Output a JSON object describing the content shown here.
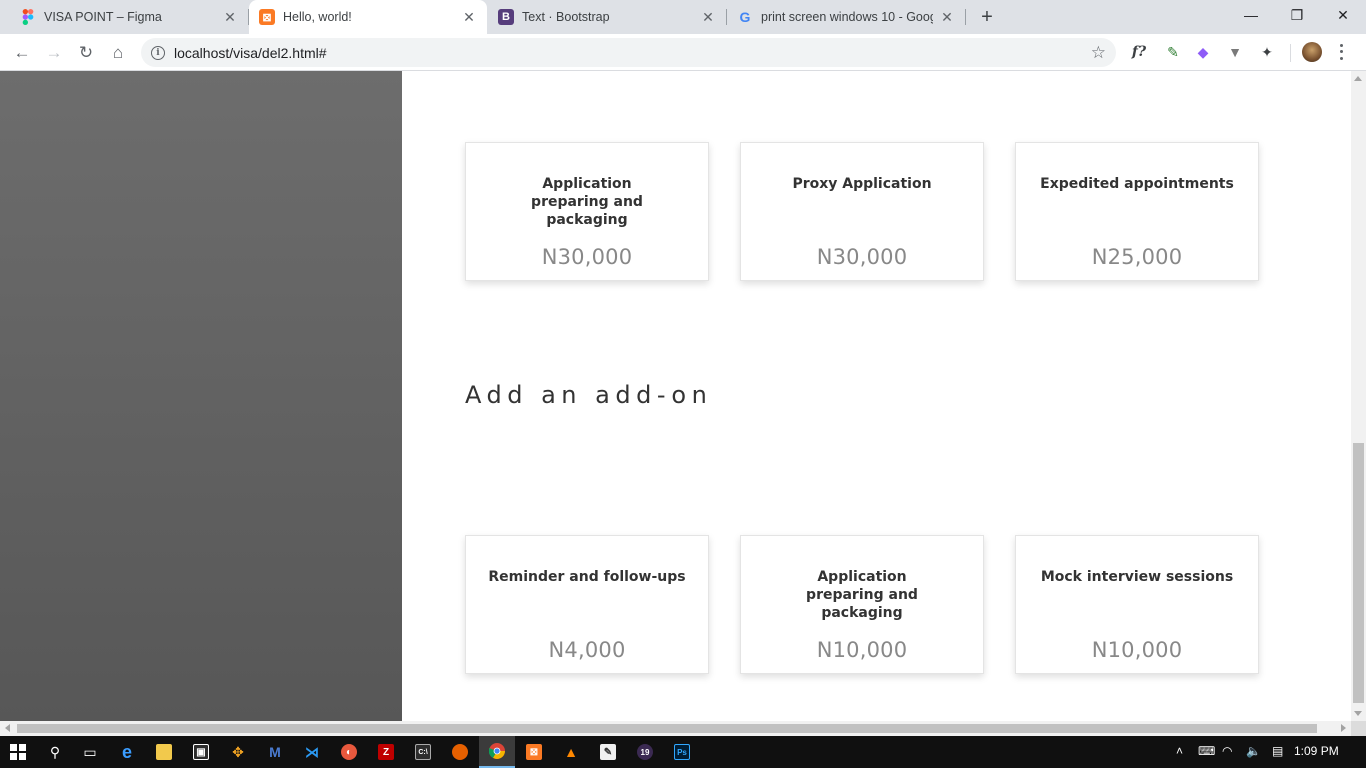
{
  "browser": {
    "tabs": [
      {
        "title": "VISA POINT – Figma",
        "icon": "figma-icon",
        "color": "#f24e1e"
      },
      {
        "title": "Hello, world!",
        "icon": "xampp-icon",
        "color": "#fb7a24"
      },
      {
        "title": "Text · Bootstrap",
        "icon": "bootstrap-icon",
        "color": "#563d7c"
      },
      {
        "title": "print screen windows 10 - Googl",
        "icon": "google-icon",
        "color": "#4285f4"
      }
    ],
    "url": "localhost/visa/del2.html#"
  },
  "page": {
    "services": [
      {
        "name": "Application preparing and packaging",
        "price": "N30,000"
      },
      {
        "name": "Proxy Application",
        "price": "N30,000"
      },
      {
        "name": "Expedited appointments",
        "price": "N25,000"
      }
    ],
    "addon_heading": "Add an add-on",
    "addons": [
      {
        "name": "Reminder and follow-ups",
        "price": "N4,000"
      },
      {
        "name": "Application preparing and packaging",
        "price": "N10,000"
      },
      {
        "name": "Mock interview sessions",
        "price": "N10,000"
      }
    ]
  },
  "taskbar": {
    "clock": "1:09 PM"
  },
  "colors": {
    "sidebar": "#5f5f5f",
    "price_text": "#888888",
    "card_title": "#333333"
  }
}
